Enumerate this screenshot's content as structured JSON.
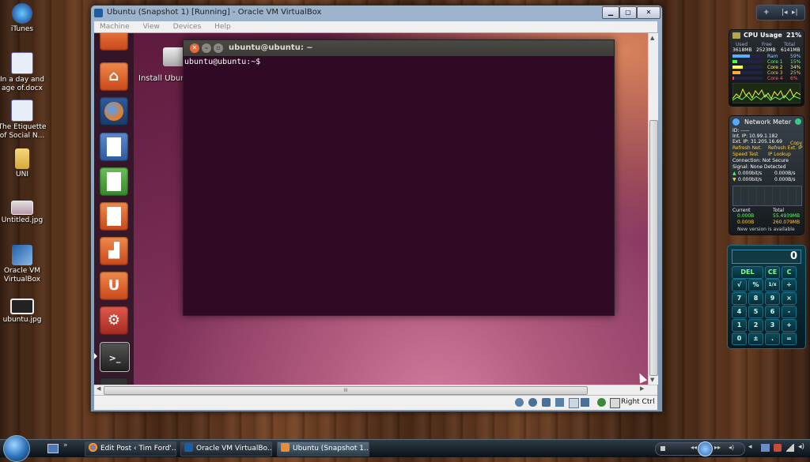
{
  "desktop": {
    "icons": [
      {
        "label": "iTunes"
      },
      {
        "label": "In a day and age of.docx"
      },
      {
        "label": "The Etiquette of Social N..."
      },
      {
        "label": "UNI"
      },
      {
        "label": "Untitled.jpg"
      },
      {
        "label": "Oracle VM VirtualBox"
      },
      {
        "label": "ubuntu.jpg"
      }
    ]
  },
  "vbox": {
    "title": "Ubuntu (Snapshot 1) [Running] - Oracle VM VirtualBox",
    "menu": [
      "Machine",
      "View",
      "Devices",
      "Help"
    ],
    "host_key": "Right Ctrl",
    "hscroll_grip": "III"
  },
  "guest": {
    "install_label": "Install Ubun",
    "terminal": {
      "title": "ubuntu@ubuntu: ~",
      "prompt": "ubuntu@ubuntu:~$"
    }
  },
  "cpu_gadget": {
    "title": "CPU Usage",
    "percent": "21%",
    "headers": [
      "Used",
      "Free",
      "Total"
    ],
    "values": [
      "3618MB",
      "2523MB",
      "6141MB"
    ],
    "rows": [
      {
        "label": "Ram",
        "value": "59%"
      },
      {
        "label": "Core 1",
        "value": "15%"
      },
      {
        "label": "Core 2",
        "value": "34%"
      },
      {
        "label": "Core 3",
        "value": "25%"
      },
      {
        "label": "Core 4",
        "value": "6%"
      }
    ]
  },
  "net_gadget": {
    "title": "Network Meter",
    "lines": [
      "ID: -----",
      "Int. IP: 10.99.1.182",
      "Ext. IP: 31.205.16.69",
      "Refresh Net.",
      "Speed Test",
      "Connection: Not Secure",
      "Signal: None Detected"
    ],
    "copy": "Copy",
    "refresh_ext": "Refresh Ext. IP",
    "ip_lookup": "IP Lookup",
    "rate_up_1": "0.000bit/s",
    "rate_up_2": "0.000B/s",
    "rate_dn_1": "0.000bit/s",
    "rate_dn_2": "0.000B/s",
    "current_label": "Current",
    "total_label": "Total",
    "cur_up": "0.000B",
    "cur_dn": "0.000B",
    "tot_up": "55.4939MB",
    "tot_dn": "260.079MB",
    "notice": "New version is available"
  },
  "calculator": {
    "display": "0",
    "keys": [
      "DEL",
      "CE",
      "C",
      "√",
      "%",
      "1/x",
      "÷",
      "7",
      "8",
      "9",
      "×",
      "4",
      "5",
      "6",
      "-",
      "1",
      "2",
      "3",
      "+",
      "0",
      "±",
      ".",
      "="
    ]
  },
  "taskbar": {
    "tasks": [
      {
        "label": "Edit Post ‹ Tim Ford'..."
      },
      {
        "label": "Oracle VM VirtualBo..."
      },
      {
        "label": "Ubuntu (Snapshot 1..."
      }
    ]
  },
  "colors": {
    "terminal_bg": "#300a24",
    "ubuntu_orange": "#dd4814"
  }
}
